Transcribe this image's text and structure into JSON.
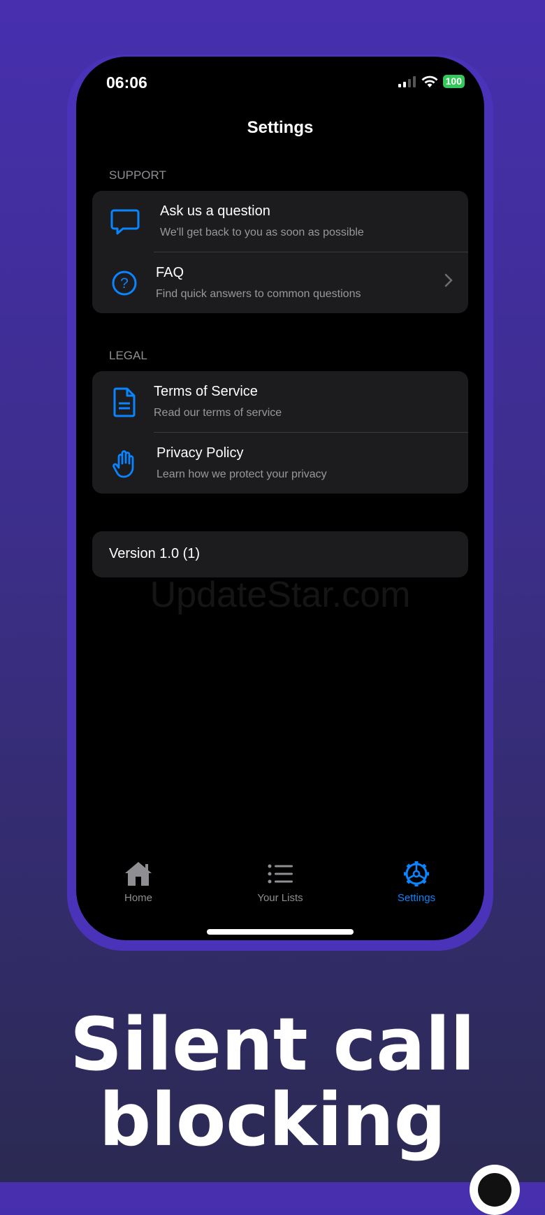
{
  "status_bar": {
    "time": "06:06",
    "battery": "100"
  },
  "nav": {
    "title": "Settings"
  },
  "support": {
    "label": "SUPPORT",
    "items": [
      {
        "title": "Ask us a question",
        "subtitle": "We'll get back to you as soon as possible",
        "icon": "chat-bubble-icon"
      },
      {
        "title": "FAQ",
        "subtitle": "Find quick answers to common questions",
        "icon": "question-circle-icon"
      }
    ]
  },
  "legal": {
    "label": "LEGAL",
    "items": [
      {
        "title": "Terms of Service",
        "subtitle": "Read our terms of service",
        "icon": "document-icon"
      },
      {
        "title": "Privacy Policy",
        "subtitle": "Learn how we protect your privacy",
        "icon": "hand-icon"
      }
    ]
  },
  "version": "Version 1.0 (1)",
  "watermark": "UpdateStar.com",
  "tabs": [
    {
      "label": "Home",
      "icon": "house-icon",
      "active": false
    },
    {
      "label": "Your Lists",
      "icon": "list-icon",
      "active": false
    },
    {
      "label": "Settings",
      "icon": "gear-icon",
      "active": true
    }
  ],
  "headline": {
    "line1": "Silent call",
    "line2": "blocking"
  },
  "colors": {
    "accent": "#0a84ff",
    "background_top": "#472fae",
    "background_bottom": "#2b2a52",
    "card": "#1c1c1e"
  }
}
